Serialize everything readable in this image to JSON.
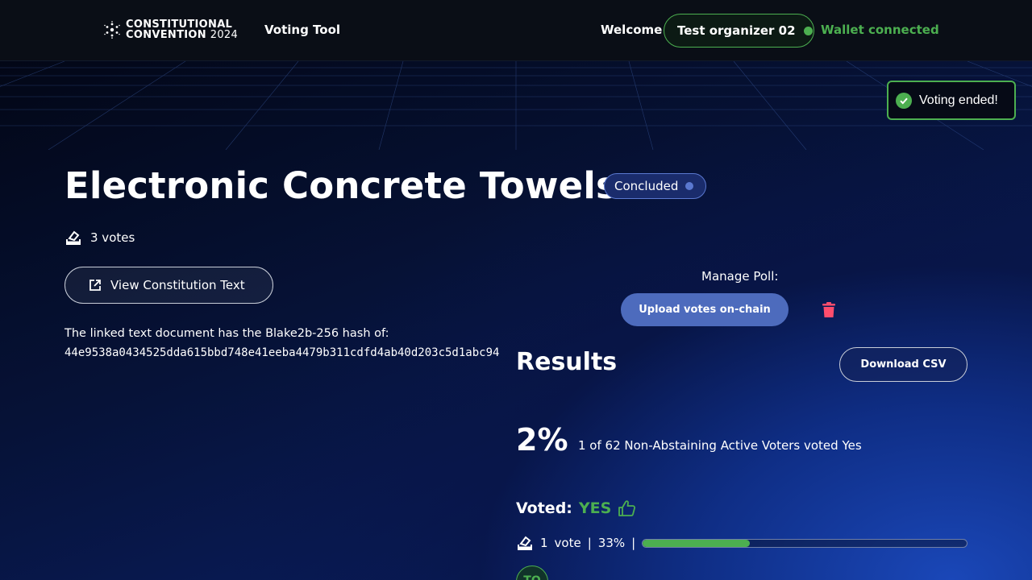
{
  "header": {
    "logo_line1": "CONSTITUTIONAL",
    "logo_line2_bold": "CONVENTION",
    "logo_line2_year": "2024",
    "nav_title": "Voting Tool",
    "welcome": "Welcome",
    "user_name": "Test organizer 02",
    "wallet_status": "Wallet connected"
  },
  "toast": {
    "message": "Voting ended!"
  },
  "poll": {
    "title": "Electronic Concrete Towels",
    "status": "Concluded",
    "votes": "3 votes",
    "view_button": "View Constitution Text",
    "hash_label": "The linked text document has the Blake2b-256 hash of:",
    "hash_value": "44e9538a0434525dda615bbd748e41eeba4479b311cdfd4ab40d203c5d1abc94"
  },
  "manage": {
    "label": "Manage Poll:",
    "upload_button": "Upload votes on-chain"
  },
  "results": {
    "title": "Results",
    "download_button": "Download CSV",
    "percent": "2%",
    "summary": "1 of 62 Non-Abstaining Active Voters voted Yes",
    "voted_label": "Voted:",
    "voted_value": "YES",
    "vote_count": "1",
    "vote_word": "vote",
    "sep1": "|",
    "vote_percent": "33%",
    "sep2": "|",
    "progress": 0.33,
    "avatar_initials": "TO"
  },
  "colors": {
    "accent_green": "#4caf50",
    "accent_blue": "#4d6bbd",
    "danger": "#ff4d6d"
  }
}
